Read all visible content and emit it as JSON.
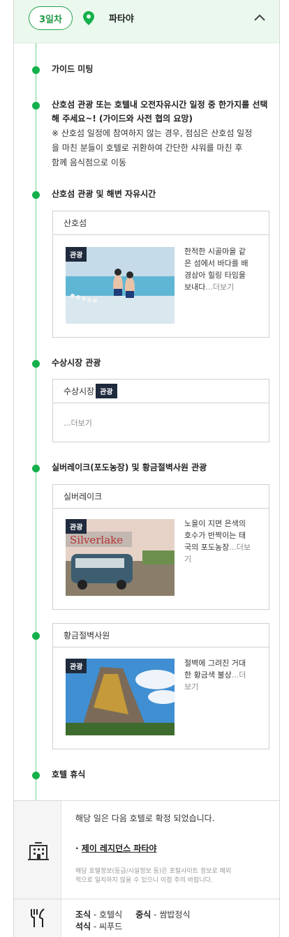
{
  "header": {
    "day_label": "3일차",
    "city": "파타야",
    "colors": {
      "accent": "#14b04b",
      "header_bg": "#eaf8ee"
    }
  },
  "steps": [
    {
      "title": "가이드 미팅"
    },
    {
      "title_line1": "산호섬 관광 또는 호텔내 오전자유시간 일정 중 한가지를 선택",
      "title_line2": "해 주세요~! (가이드와 사전 협의 요망)",
      "note_line1": "※ 산호섬 일정에 참여하지 않는 경우, 점심은 산호섬 일정",
      "note_line2": "을 마친 분들이 호텔로 귀환하여 간단한 샤워를 마친 후",
      "note_line3": "함께 음식점으로 이동"
    },
    {
      "title": "산호섬 관광 및 해변 자유시간",
      "card": {
        "name": "산호섬",
        "badge": "관광",
        "desc_lines": [
          "한적한 시골마을 같",
          "은 섬에서 바다를 배",
          "경삼아 힐링 타임을",
          "보내다"
        ],
        "more": "...더보기"
      }
    },
    {
      "title": "수상시장 관광",
      "card": {
        "name": "수상시장",
        "badge": "관광",
        "more": "...더보기"
      }
    },
    {
      "title": "실버레이크(포도농장) 및 황금절벽사원 관광",
      "card1": {
        "name": "실버레이크",
        "badge": "관광",
        "desc_lines": [
          "노을이 지면 은색의",
          "호수가 반짝이는 태",
          "국의 포도농장"
        ],
        "more1": "...더보",
        "more2": "기"
      },
      "card2": {
        "name": "황금절벽사원",
        "badge": "관광",
        "desc_lines": [
          "절벽에 그려진 거대",
          "한 황금색 불상"
        ],
        "more1": "...더",
        "more2": "보기"
      }
    },
    {
      "title": "호텔 휴식"
    }
  ],
  "hotel": {
    "confirm_text": "해당 일은 다음 호텔로 확정 되었습니다.",
    "bullet": "·",
    "hotel_name": "제이 레지던스 파타야",
    "note_line1": "해당 호텔정보(등급/시설정보 등)은 포털사이트 정보로 예외",
    "note_line2": "적으로 일치하지 않을 수 있으니 이점 주의 바랍니다.",
    "icon": "building-icon"
  },
  "meals": {
    "icon": "utensils-icon",
    "breakfast_label": "조식",
    "breakfast_value": " - 호텔식",
    "lunch_label": "중식",
    "lunch_value": " - 쌈밥정식",
    "dinner_label": "석식",
    "dinner_value": " - 씨푸드"
  }
}
